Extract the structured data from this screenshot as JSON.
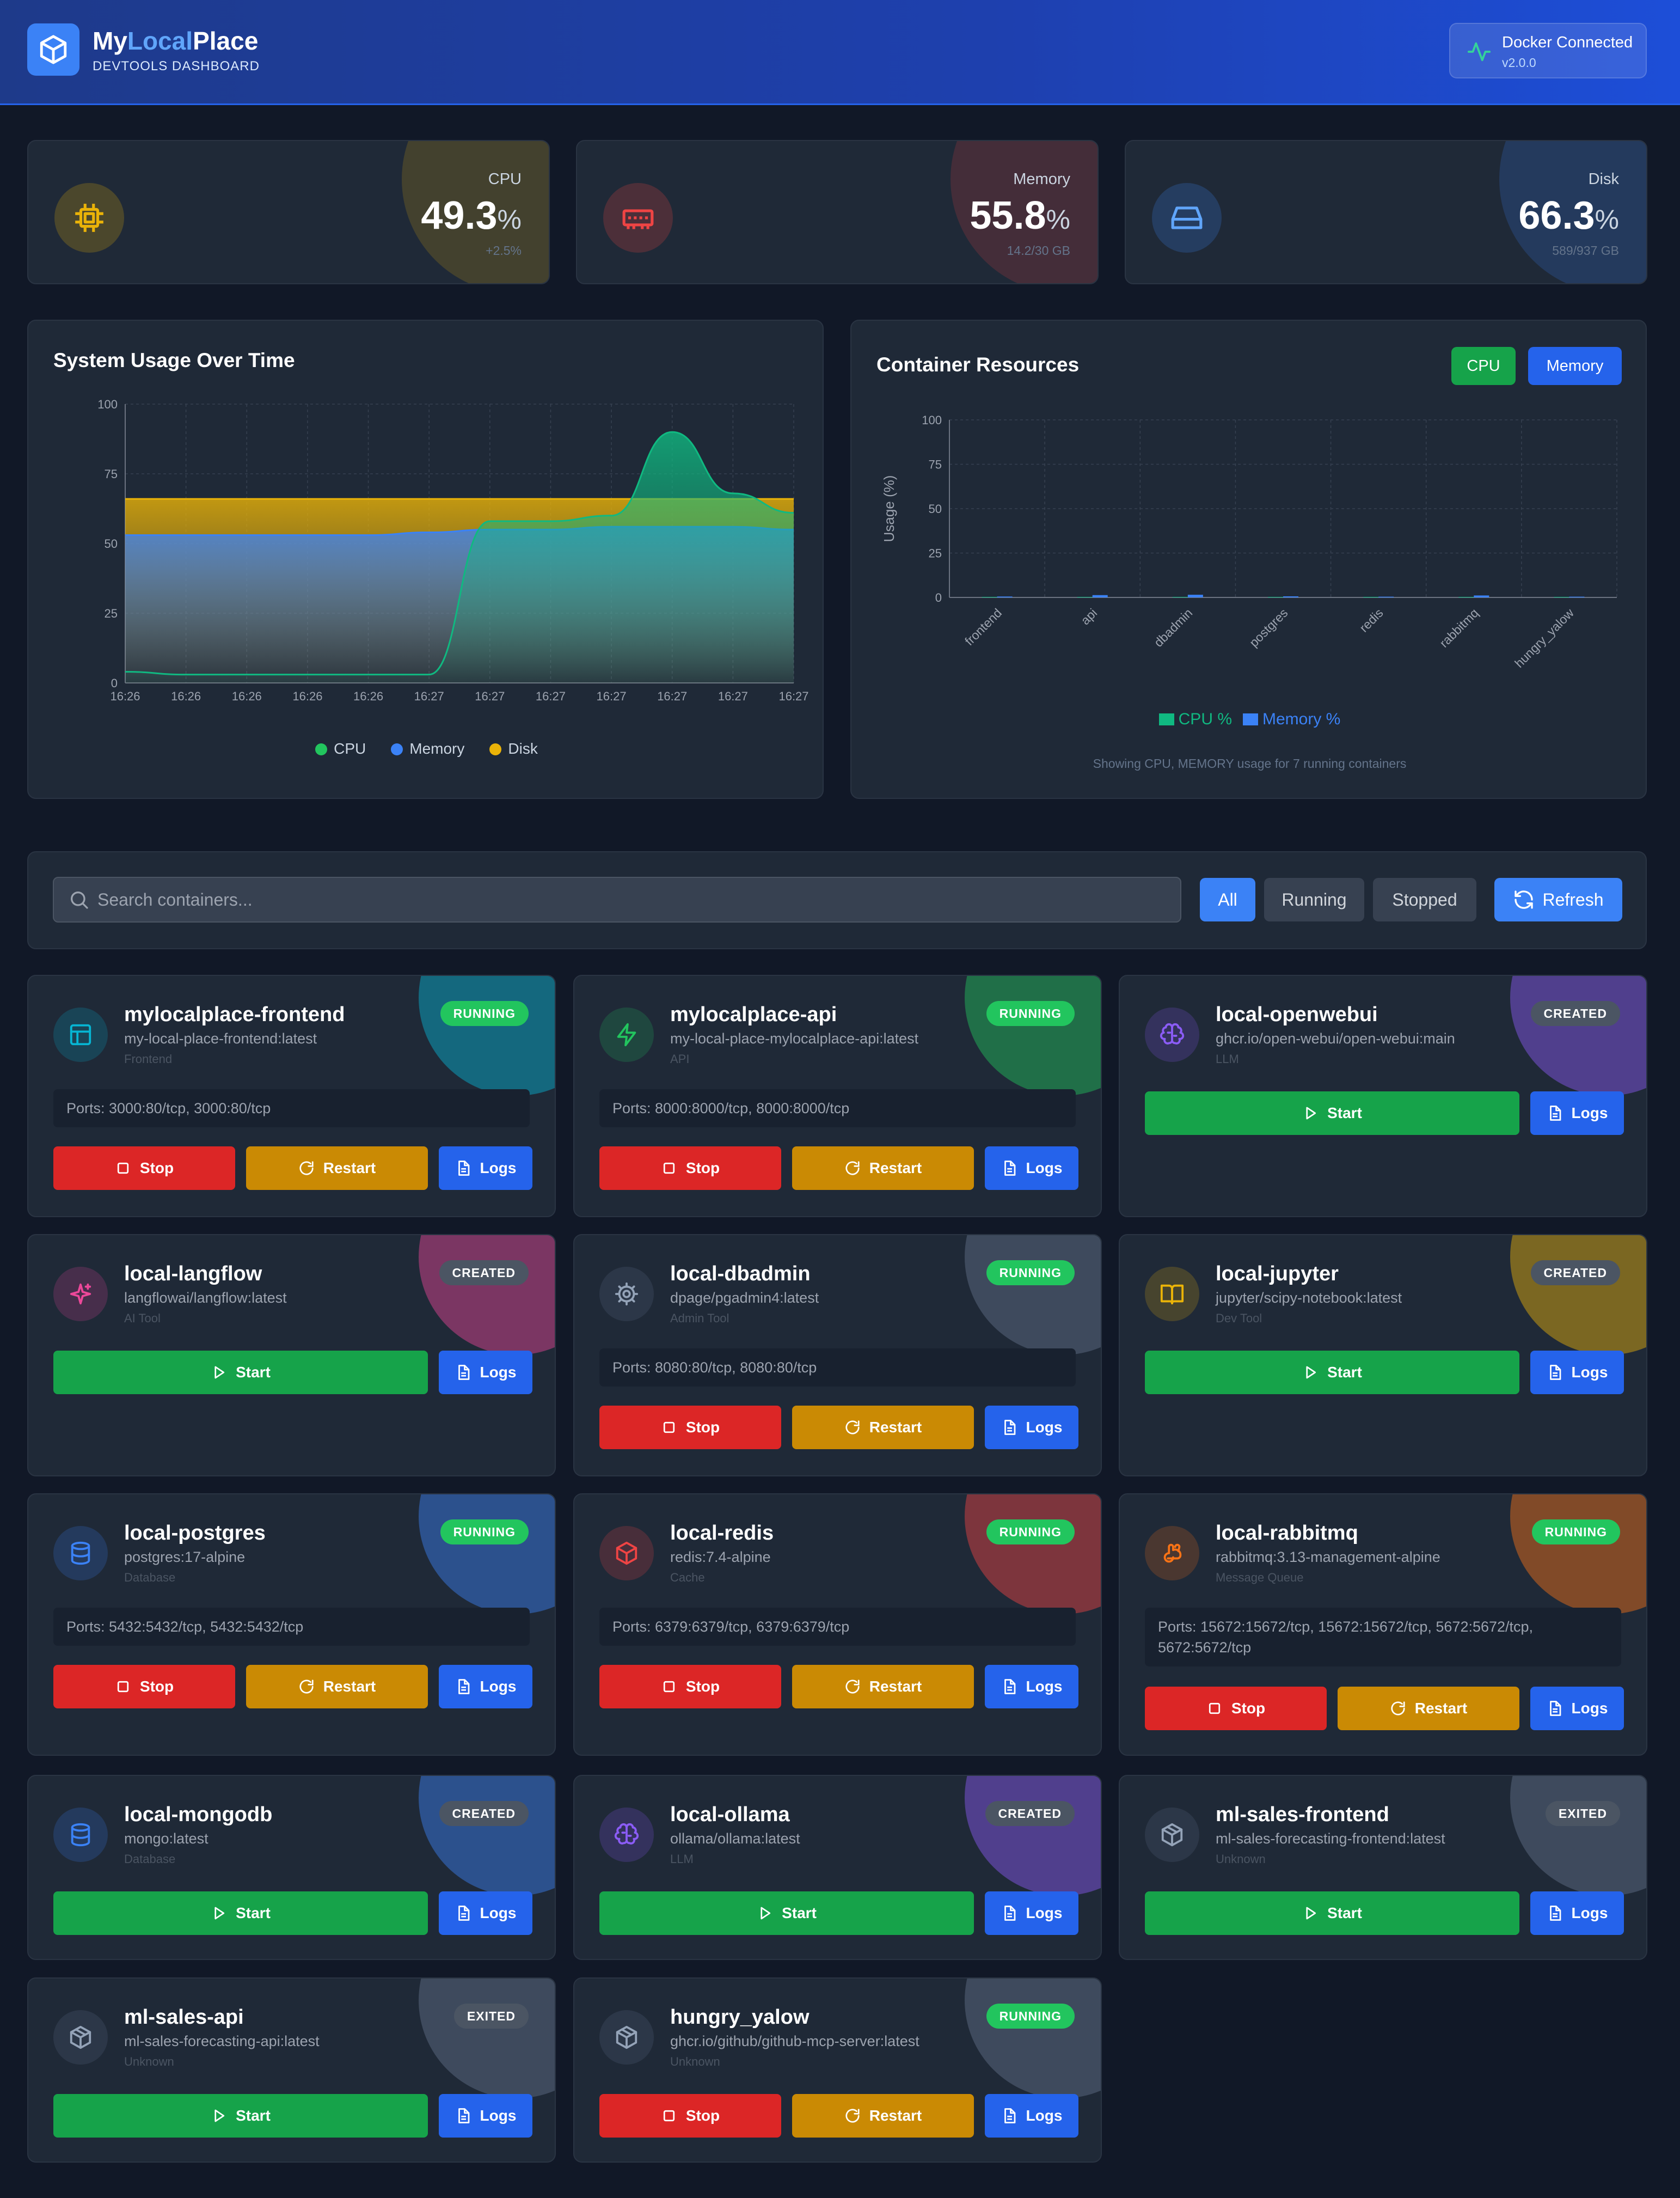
{
  "header": {
    "brand_part1": "My",
    "brand_part2": "Local",
    "brand_part3": "Place",
    "subtitle": "DEVTOOLS DASHBOARD",
    "docker_status": "Docker Connected",
    "version": "v2.0.0"
  },
  "stats": [
    {
      "label": "CPU",
      "value": "49.3",
      "unit": "%",
      "sub": "+2.5%",
      "color": "#eab308"
    },
    {
      "label": "Memory",
      "value": "55.8",
      "unit": "%",
      "sub": "14.2/30 GB",
      "color": "#ef4444"
    },
    {
      "label": "Disk",
      "value": "66.3",
      "unit": "%",
      "sub": "589/937 GB",
      "color": "#3b82f6"
    }
  ],
  "system_chart": {
    "title": "System Usage Over Time",
    "legend": [
      "CPU",
      "Memory",
      "Disk"
    ]
  },
  "resources_chart": {
    "title": "Container Resources",
    "btn_cpu": "CPU",
    "btn_memory": "Memory",
    "footnote": "Showing CPU, MEMORY usage for 7 running containers",
    "legend_cpu": "CPU %",
    "legend_memory": "Memory %"
  },
  "chart_data": [
    {
      "type": "area",
      "title": "System Usage Over Time",
      "x": [
        "16:26",
        "16:26",
        "16:26",
        "16:26",
        "16:26",
        "16:27",
        "16:27",
        "16:27",
        "16:27",
        "16:27",
        "16:27",
        "16:27"
      ],
      "ylim": [
        0,
        100
      ],
      "yticks": [
        0,
        25,
        50,
        75,
        100
      ],
      "series": [
        {
          "name": "CPU",
          "color": "#10b981",
          "values": [
            4,
            3,
            3,
            3,
            3,
            3,
            58,
            58,
            60,
            90,
            68,
            61
          ]
        },
        {
          "name": "Memory",
          "color": "#3b82f6",
          "values": [
            53,
            53,
            53,
            53,
            53,
            54,
            55,
            55,
            56,
            56,
            56,
            55
          ]
        },
        {
          "name": "Disk",
          "color": "#eab308",
          "values": [
            66,
            66,
            66,
            66,
            66,
            66,
            66,
            66,
            66,
            66,
            66,
            66
          ]
        }
      ],
      "legend_position": "bottom",
      "grid": true
    },
    {
      "type": "bar",
      "title": "Container Resources",
      "ylabel": "Usage (%)",
      "ylim": [
        0,
        100
      ],
      "yticks": [
        0,
        25,
        50,
        75,
        100
      ],
      "categories": [
        "frontend",
        "api",
        "dbadmin",
        "postgres",
        "redis",
        "rabbitmq",
        "hungry_yalow"
      ],
      "series": [
        {
          "name": "CPU %",
          "color": "#10b981",
          "values": [
            0,
            0,
            0,
            0,
            0,
            0,
            0
          ]
        },
        {
          "name": "Memory %",
          "color": "#3b82f6",
          "values": [
            0.2,
            1.0,
            1.2,
            0.3,
            0.1,
            0.8,
            0.1
          ]
        }
      ],
      "legend_position": "bottom",
      "grid": true
    }
  ],
  "filters": {
    "search_placeholder": "Search containers...",
    "all": "All",
    "running": "Running",
    "stopped": "Stopped",
    "refresh": "Refresh"
  },
  "labels": {
    "stop": "Stop",
    "restart": "Restart",
    "logs": "Logs",
    "start": "Start"
  },
  "containers": [
    {
      "name": "mylocalplace-frontend",
      "image": "my-local-place-frontend:latest",
      "category": "Frontend",
      "status": "RUNNING",
      "ports": "Ports: 3000:80/tcp, 3000:80/tcp",
      "color": "#06b6d4",
      "icon": "layout-icon"
    },
    {
      "name": "mylocalplace-api",
      "image": "my-local-place-mylocalplace-api:latest",
      "category": "API",
      "status": "RUNNING",
      "ports": "Ports: 8000:8000/tcp, 8000:8000/tcp",
      "color": "#22c55e",
      "icon": "bolt-icon"
    },
    {
      "name": "local-openwebui",
      "image": "ghcr.io/open-webui/open-webui:main",
      "category": "LLM",
      "status": "CREATED",
      "ports": "",
      "color": "#8b5cf6",
      "icon": "brain-icon"
    },
    {
      "name": "local-langflow",
      "image": "langflowai/langflow:latest",
      "category": "AI Tool",
      "status": "CREATED",
      "ports": "",
      "color": "#ec4899",
      "icon": "sparkles-icon"
    },
    {
      "name": "local-dbadmin",
      "image": "dpage/pgadmin4:latest",
      "category": "Admin Tool",
      "status": "RUNNING",
      "ports": "Ports: 8080:80/tcp, 8080:80/tcp",
      "color": "#64748b",
      "icon": "gear-icon"
    },
    {
      "name": "local-jupyter",
      "image": "jupyter/scipy-notebook:latest",
      "category": "Dev Tool",
      "status": "CREATED",
      "ports": "",
      "color": "#eab308",
      "icon": "book-icon"
    },
    {
      "name": "local-postgres",
      "image": "postgres:17-alpine",
      "category": "Database",
      "status": "RUNNING",
      "ports": "Ports: 5432:5432/tcp, 5432:5432/tcp",
      "color": "#3b82f6",
      "icon": "database-icon"
    },
    {
      "name": "local-redis",
      "image": "redis:7.4-alpine",
      "category": "Cache",
      "status": "RUNNING",
      "ports": "Ports: 6379:6379/tcp, 6379:6379/tcp",
      "color": "#ef4444",
      "icon": "cube-icon"
    },
    {
      "name": "local-rabbitmq",
      "image": "rabbitmq:3.13-management-alpine",
      "category": "Message Queue",
      "status": "RUNNING",
      "ports": "Ports: 15672:15672/tcp, 15672:15672/tcp, 5672:5672/tcp, 5672:5672/tcp",
      "color": "#f97316",
      "icon": "rabbit-icon"
    },
    {
      "name": "local-mongodb",
      "image": "mongo:latest",
      "category": "Database",
      "status": "CREATED",
      "ports": "",
      "color": "#3b82f6",
      "icon": "database-icon"
    },
    {
      "name": "local-ollama",
      "image": "ollama/ollama:latest",
      "category": "LLM",
      "status": "CREATED",
      "ports": "",
      "color": "#8b5cf6",
      "icon": "brain-icon"
    },
    {
      "name": "ml-sales-frontend",
      "image": "ml-sales-forecasting-frontend:latest",
      "category": "Unknown",
      "status": "EXITED",
      "ports": "",
      "color": "#64748b",
      "icon": "box-icon"
    },
    {
      "name": "ml-sales-api",
      "image": "ml-sales-forecasting-api:latest",
      "category": "Unknown",
      "status": "EXITED",
      "ports": "",
      "color": "#64748b",
      "icon": "box-icon"
    },
    {
      "name": "hungry_yalow",
      "image": "ghcr.io/github/github-mcp-server:latest",
      "category": "Unknown",
      "status": "RUNNING",
      "ports": "",
      "color": "#64748b",
      "icon": "box-icon"
    }
  ]
}
